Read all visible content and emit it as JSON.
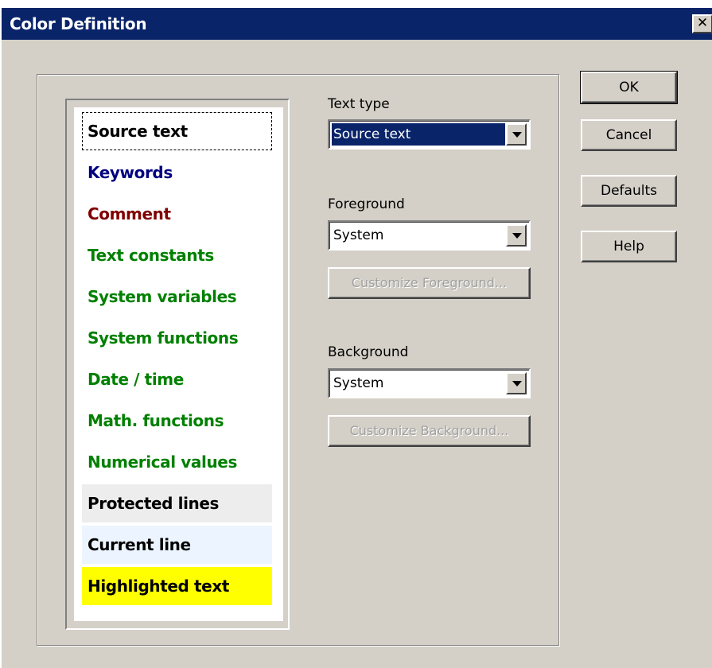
{
  "window": {
    "title": "Color Definition",
    "close_glyph": "✕"
  },
  "text_types": [
    {
      "label": "Source text",
      "color": "#000000",
      "background": "#ffffff"
    },
    {
      "label": "Keywords",
      "color": "#000080",
      "background": "#ffffff"
    },
    {
      "label": "Comment",
      "color": "#800000",
      "background": "#ffffff"
    },
    {
      "label": "Text constants",
      "color": "#008000",
      "background": "#ffffff"
    },
    {
      "label": "System variables",
      "color": "#008000",
      "background": "#ffffff"
    },
    {
      "label": "System functions",
      "color": "#008000",
      "background": "#ffffff"
    },
    {
      "label": "Date / time",
      "color": "#008000",
      "background": "#ffffff"
    },
    {
      "label": "Math. functions",
      "color": "#008000",
      "background": "#ffffff"
    },
    {
      "label": "Numerical values",
      "color": "#008000",
      "background": "#ffffff"
    },
    {
      "label": "Protected lines",
      "color": "#000000",
      "background": "#ededed"
    },
    {
      "label": "Current line",
      "color": "#000000",
      "background": "#ecf5ff"
    },
    {
      "label": "Highlighted text",
      "color": "#000000",
      "background": "#ffff00"
    }
  ],
  "text_type": {
    "label": "Text type",
    "value": "Source text"
  },
  "foreground": {
    "label": "Foreground",
    "value": "System",
    "customize_label": "Customize Foreground..."
  },
  "background": {
    "label": "Background",
    "value": "System",
    "customize_label": "Customize Background..."
  },
  "buttons": {
    "ok": "OK",
    "cancel": "Cancel",
    "defaults": "Defaults",
    "help": "Help"
  }
}
